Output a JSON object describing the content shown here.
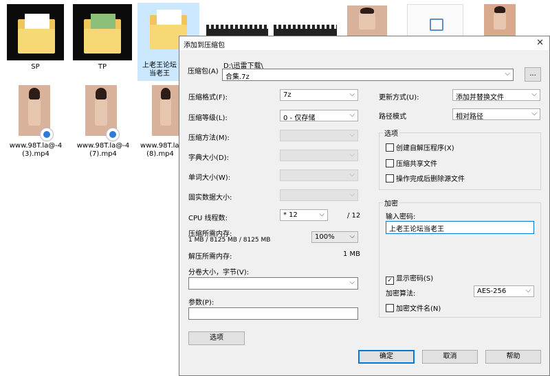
{
  "desktop": {
    "folders": [
      {
        "label": "SP"
      },
      {
        "label": "TP"
      },
      {
        "label": "上老王论坛当老王"
      }
    ],
    "videos": [
      {
        "label": "www.98T.la@-4 (3).mp4"
      },
      {
        "label": "www.98T.la@-4 (7).mp4"
      },
      {
        "label": "www.98T.la@-4 (8).mp4"
      }
    ]
  },
  "dialog": {
    "title": "添加到压缩包",
    "close_label": "✕",
    "archive_label": "压缩包(A)",
    "archive_path": "D:\\迅雷下载\\",
    "archive_name": "合集.7z",
    "browse_label": "...",
    "format_label": "压缩格式(F):",
    "format_value": "7z",
    "level_label": "压缩等级(L):",
    "level_value": "0 - 仅存储",
    "method_label": "压缩方法(M):",
    "dict_label": "字典大小(D):",
    "word_label": "单词大小(W):",
    "solid_label": "固实数据大小:",
    "cpu_label": "CPU 线程数:",
    "cpu_value": "* 12",
    "cpu_max": "/ 12",
    "mem_comp_label": "压缩所需内存:",
    "mem_comp_detail": "1 MB / 8125 MB / 8125 MB",
    "mem_percent": "100%",
    "mem_decomp_label": "解压所需内存:",
    "mem_decomp_value": "1 MB",
    "split_label": "分卷大小，字节(V):",
    "params_label": "参数(P):",
    "options_button": "选项",
    "update_label": "更新方式(U):",
    "update_value": "添加并替换文件",
    "path_label": "路径模式",
    "path_value": "相对路径",
    "options_group": "选项",
    "opt_sfx": "创建自解压程序(X)",
    "opt_shared": "压缩共享文件",
    "opt_delete": "操作完成后删除源文件",
    "encrypt_group": "加密",
    "password_label": "输入密码:",
    "password_value": "上老王论坛当老王",
    "show_password": "显示密码(S)",
    "algo_label": "加密算法:",
    "algo_value": "AES-256",
    "encrypt_names": "加密文件名(N)",
    "ok": "确定",
    "cancel": "取消",
    "help": "帮助"
  }
}
